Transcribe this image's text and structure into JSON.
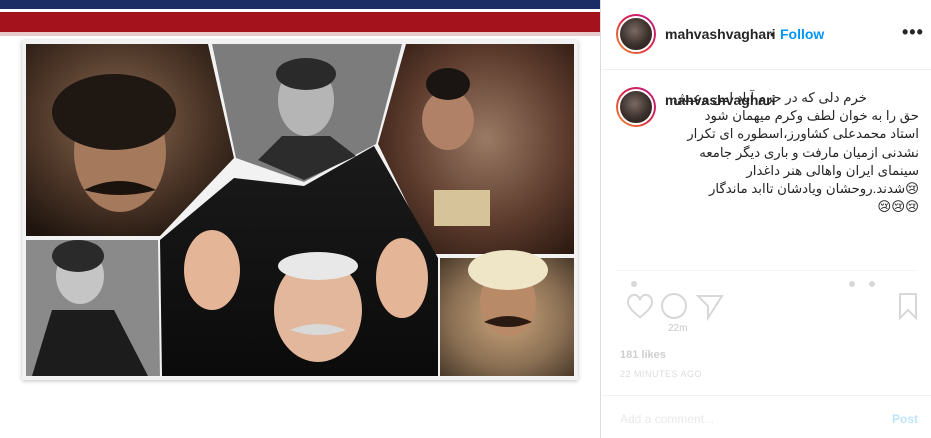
{
  "post": {
    "username": "mahvashvaghari",
    "dot": "•",
    "follow_label": "Follow",
    "more_label": "•••"
  },
  "caption": {
    "username": "mahvashvaghari",
    "lines": [
      "خرم دلی که در حرم آباد امن وعیش",
      "حق را به خوان لطف وکرم میهمان شود",
      "استاد محمدعلی کشاورز،اسطوره ای تکرار",
      "نشدنی ازمیان مارفت و باری دیگر جامعه",
      "سینمای ایران واهالی هنر داغدار",
      "😢شدند.روحشان ویادشان تاابد ماندگار",
      "😢😢😢"
    ],
    "time": "22m"
  },
  "faded": {
    "likes": "181 likes",
    "ago": "22 MINUTES AGO",
    "comment_placeholder": "Add a comment...",
    "post_label": "Post"
  },
  "colors": {
    "banner_blue": "#1c2d66",
    "banner_red": "#a4121b",
    "follow_blue": "#0095f6"
  },
  "icons": {
    "more": "more-horizontal-icon",
    "like": "heart-icon",
    "comment": "comment-icon",
    "share": "share-icon",
    "save": "bookmark-icon"
  }
}
